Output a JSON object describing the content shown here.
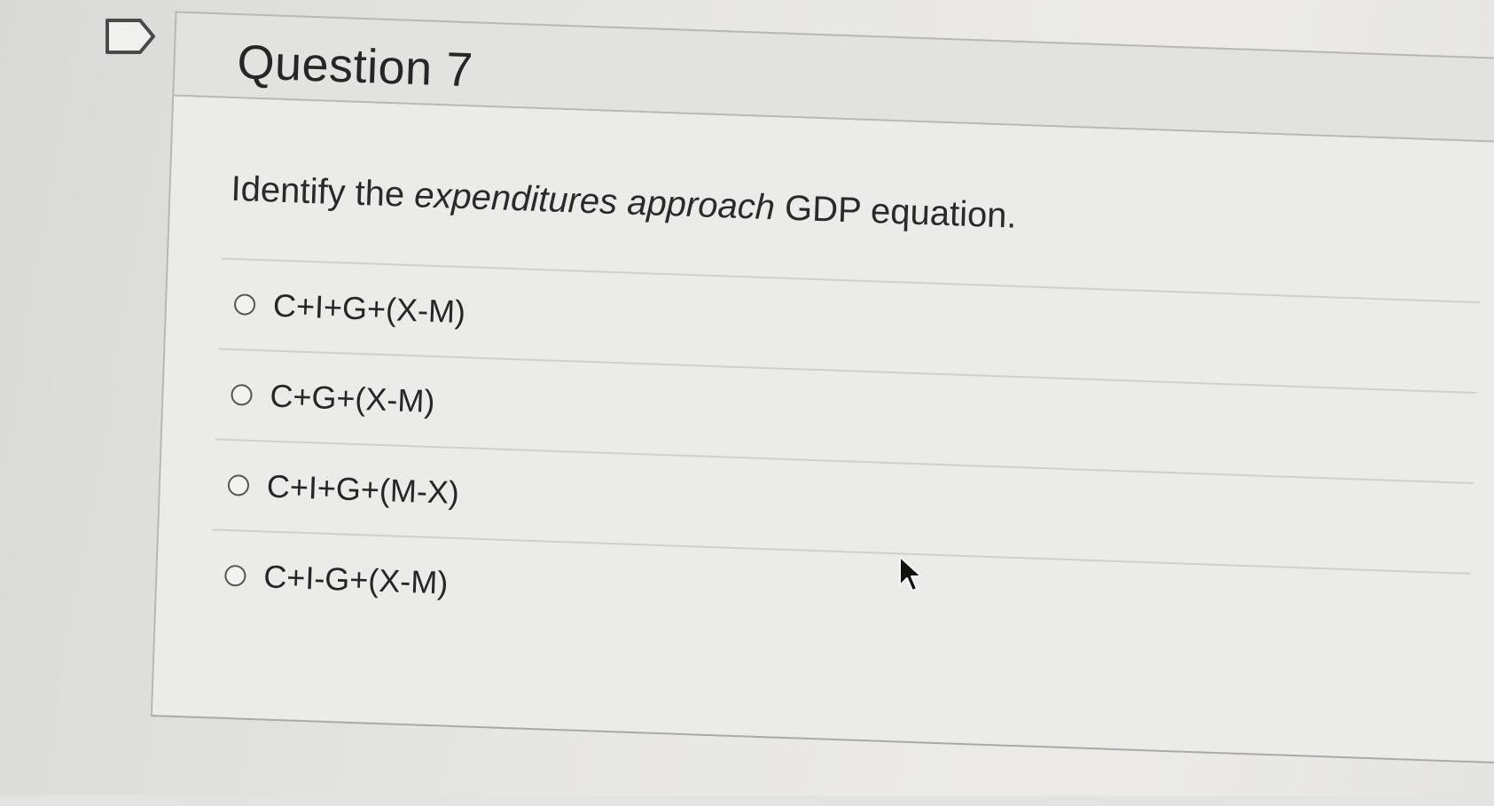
{
  "question": {
    "title": "Question 7",
    "prompt_before": "Identify the ",
    "prompt_emphasis": "expenditures approach",
    "prompt_after": " GDP equation."
  },
  "answers": [
    {
      "label": "C+I+G+(X-M)",
      "selected": false
    },
    {
      "label": "C+G+(X-M)",
      "selected": false
    },
    {
      "label": "C+I+G+(M-X)",
      "selected": false
    },
    {
      "label": "C+I-G+(X-M)",
      "selected": false
    }
  ],
  "icons": {
    "flag": "flag-icon",
    "cursor": "cursor-arrow-icon"
  }
}
